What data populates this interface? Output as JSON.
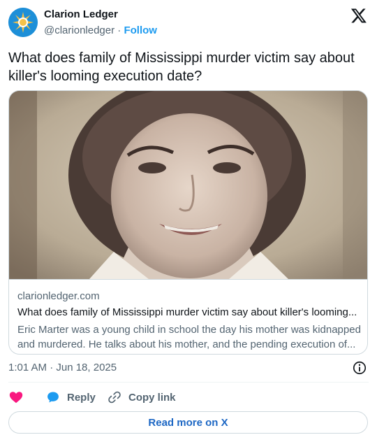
{
  "author": {
    "name": "Clarion Ledger",
    "handle": "@clarionledger",
    "separator": " · ",
    "follow_label": "Follow"
  },
  "tweet": {
    "text": "What does family of Mississippi murder victim say about killer's looming execution date?"
  },
  "card": {
    "domain": "clarionledger.com",
    "title": "What does family of Mississippi murder victim say about killer's looming...",
    "description": "Eric Marter was a young child in school the day his mother was kidnapped and murdered. He talks about his mother, and the pending execution of..."
  },
  "meta": {
    "timestamp": "1:01 AM · Jun 18, 2025"
  },
  "actions": {
    "reply_label": "Reply",
    "copy_label": "Copy link"
  },
  "read_more_label": "Read more on X",
  "colors": {
    "accent": "#1d9bf0",
    "like": "#f91880",
    "reply": "#1d9bf0",
    "read_more": "#1d67c4",
    "text": "#0f1419",
    "secondary": "#536471"
  },
  "icons": {
    "logo": "x-logo-icon",
    "info": "info-icon",
    "like": "heart-icon",
    "reply": "speech-bubble-icon",
    "copy": "link-icon",
    "avatar": "sun-logo-icon"
  }
}
